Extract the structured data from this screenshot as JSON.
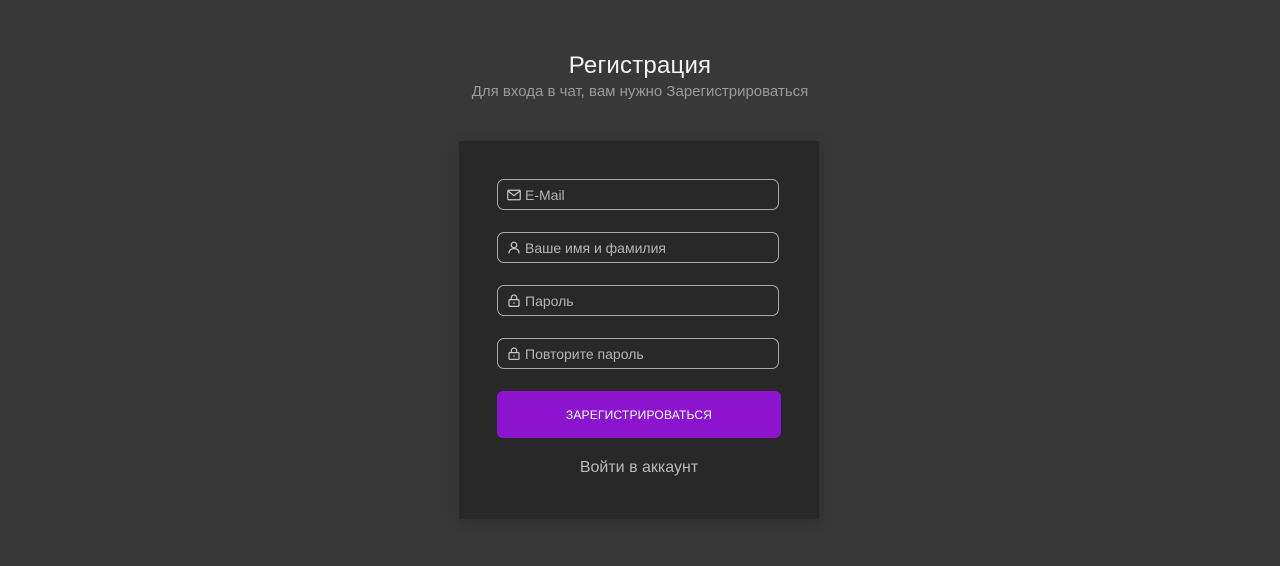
{
  "header": {
    "title": "Регистрация",
    "subtitle": "Для входа в чат, вам нужно Зарегистрироваться"
  },
  "form": {
    "fields": [
      {
        "icon": "mail-icon",
        "placeholder": "E-Mail",
        "value": ""
      },
      {
        "icon": "user-icon",
        "placeholder": "Ваше имя и фамилия",
        "value": ""
      },
      {
        "icon": "lock-icon",
        "placeholder": "Пароль",
        "value": ""
      },
      {
        "icon": "lock-icon",
        "placeholder": "Повторите пароль",
        "value": ""
      }
    ],
    "submit_label": "ЗАРЕГИСТРИРОВАТЬСЯ",
    "login_link": "Войти в аккаунт"
  },
  "colors": {
    "background": "#383838",
    "card": "#282828",
    "accent": "#8c14cf",
    "field_border": "#a8a8a8"
  }
}
